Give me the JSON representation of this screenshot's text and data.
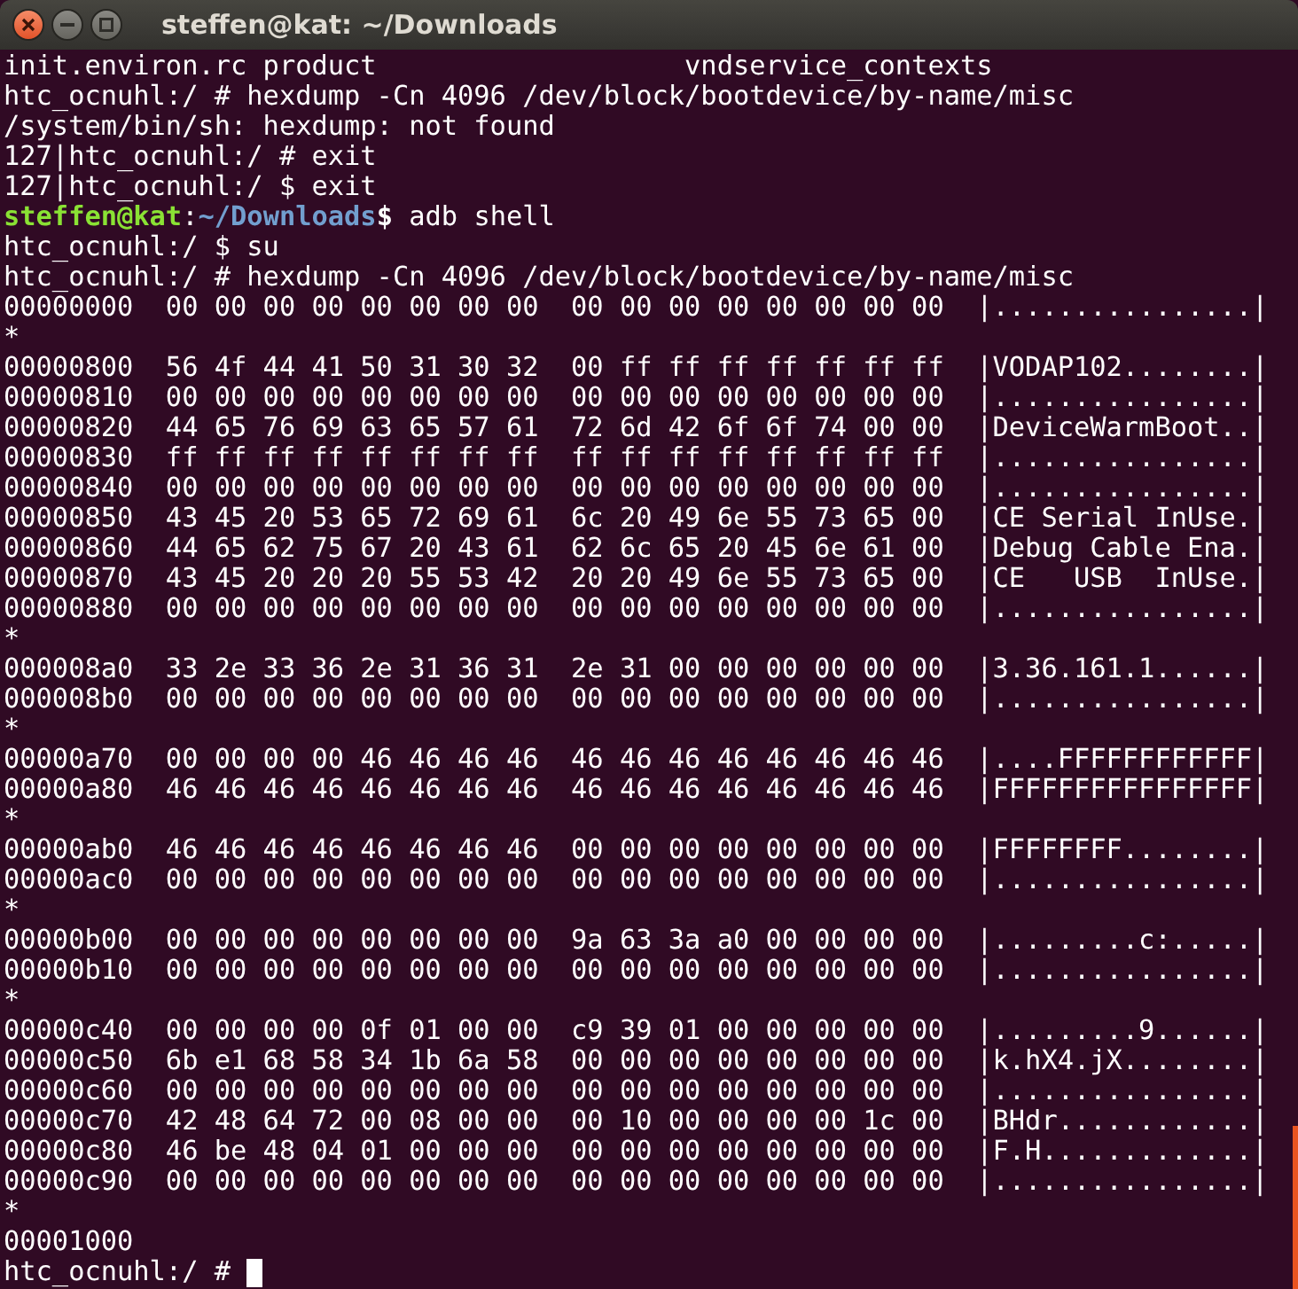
{
  "window": {
    "title": "steffen@kat: ~/Downloads"
  },
  "lines": [
    {
      "kind": "output",
      "text": "init.environ.rc product                   vndservice_contexts"
    },
    {
      "kind": "output",
      "text": "htc_ocnuhl:/ # hexdump -Cn 4096 /dev/block/bootdevice/by-name/misc"
    },
    {
      "kind": "output",
      "text": "/system/bin/sh: hexdump: not found"
    },
    {
      "kind": "output",
      "text": "127|htc_ocnuhl:/ # exit"
    },
    {
      "kind": "output",
      "text": "127|htc_ocnuhl:/ $ exit"
    },
    {
      "kind": "prompt",
      "user": "steffen@kat",
      "separator": ":",
      "path": "~/Downloads",
      "symbol": "$",
      "text": " adb shell"
    },
    {
      "kind": "output",
      "text": "htc_ocnuhl:/ $ su"
    },
    {
      "kind": "output",
      "text": "htc_ocnuhl:/ # hexdump -Cn 4096 /dev/block/bootdevice/by-name/misc"
    },
    {
      "kind": "output",
      "text": "00000000  00 00 00 00 00 00 00 00  00 00 00 00 00 00 00 00  |................|"
    },
    {
      "kind": "output",
      "text": "*"
    },
    {
      "kind": "output",
      "text": "00000800  56 4f 44 41 50 31 30 32  00 ff ff ff ff ff ff ff  |VODAP102........|"
    },
    {
      "kind": "output",
      "text": "00000810  00 00 00 00 00 00 00 00  00 00 00 00 00 00 00 00  |................|"
    },
    {
      "kind": "output",
      "text": "00000820  44 65 76 69 63 65 57 61  72 6d 42 6f 6f 74 00 00  |DeviceWarmBoot..|"
    },
    {
      "kind": "output",
      "text": "00000830  ff ff ff ff ff ff ff ff  ff ff ff ff ff ff ff ff  |................|"
    },
    {
      "kind": "output",
      "text": "00000840  00 00 00 00 00 00 00 00  00 00 00 00 00 00 00 00  |................|"
    },
    {
      "kind": "output",
      "text": "00000850  43 45 20 53 65 72 69 61  6c 20 49 6e 55 73 65 00  |CE Serial InUse.|"
    },
    {
      "kind": "output",
      "text": "00000860  44 65 62 75 67 20 43 61  62 6c 65 20 45 6e 61 00  |Debug Cable Ena.|"
    },
    {
      "kind": "output",
      "text": "00000870  43 45 20 20 20 55 53 42  20 20 49 6e 55 73 65 00  |CE   USB  InUse.|"
    },
    {
      "kind": "output",
      "text": "00000880  00 00 00 00 00 00 00 00  00 00 00 00 00 00 00 00  |................|"
    },
    {
      "kind": "output",
      "text": "*"
    },
    {
      "kind": "output",
      "text": "000008a0  33 2e 33 36 2e 31 36 31  2e 31 00 00 00 00 00 00  |3.36.161.1......|"
    },
    {
      "kind": "output",
      "text": "000008b0  00 00 00 00 00 00 00 00  00 00 00 00 00 00 00 00  |................|"
    },
    {
      "kind": "output",
      "text": "*"
    },
    {
      "kind": "output",
      "text": "00000a70  00 00 00 00 46 46 46 46  46 46 46 46 46 46 46 46  |....FFFFFFFFFFFF|"
    },
    {
      "kind": "output",
      "text": "00000a80  46 46 46 46 46 46 46 46  46 46 46 46 46 46 46 46  |FFFFFFFFFFFFFFFF|"
    },
    {
      "kind": "output",
      "text": "*"
    },
    {
      "kind": "output",
      "text": "00000ab0  46 46 46 46 46 46 46 46  00 00 00 00 00 00 00 00  |FFFFFFFF........|"
    },
    {
      "kind": "output",
      "text": "00000ac0  00 00 00 00 00 00 00 00  00 00 00 00 00 00 00 00  |................|"
    },
    {
      "kind": "output",
      "text": "*"
    },
    {
      "kind": "output",
      "text": "00000b00  00 00 00 00 00 00 00 00  9a 63 3a a0 00 00 00 00  |.........c:.....|"
    },
    {
      "kind": "output",
      "text": "00000b10  00 00 00 00 00 00 00 00  00 00 00 00 00 00 00 00  |................|"
    },
    {
      "kind": "output",
      "text": "*"
    },
    {
      "kind": "output",
      "text": "00000c40  00 00 00 00 0f 01 00 00  c9 39 01 00 00 00 00 00  |.........9......|"
    },
    {
      "kind": "output",
      "text": "00000c50  6b e1 68 58 34 1b 6a 58  00 00 00 00 00 00 00 00  |k.hX4.jX........|"
    },
    {
      "kind": "output",
      "text": "00000c60  00 00 00 00 00 00 00 00  00 00 00 00 00 00 00 00  |................|"
    },
    {
      "kind": "output",
      "text": "00000c70  42 48 64 72 00 08 00 00  00 10 00 00 00 00 1c 00  |BHdr............|"
    },
    {
      "kind": "output",
      "text": "00000c80  46 be 48 04 01 00 00 00  00 00 00 00 00 00 00 00  |F.H.............|"
    },
    {
      "kind": "output",
      "text": "00000c90  00 00 00 00 00 00 00 00  00 00 00 00 00 00 00 00  |................|"
    },
    {
      "kind": "output",
      "text": "*"
    },
    {
      "kind": "output",
      "text": "00001000"
    },
    {
      "kind": "input",
      "text": "htc_ocnuhl:/ # "
    }
  ]
}
